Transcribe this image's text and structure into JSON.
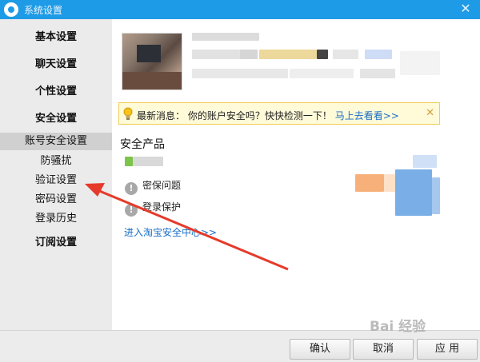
{
  "window": {
    "title": "系统设置",
    "close_icon": "close-icon"
  },
  "sidebar": {
    "items": [
      {
        "label": "基本设置"
      },
      {
        "label": "聊天设置"
      },
      {
        "label": "个性设置"
      },
      {
        "label": "安全设置"
      },
      {
        "label": "账号安全设置"
      },
      {
        "label": "防骚扰"
      },
      {
        "label": "验证设置"
      },
      {
        "label": "密码设置"
      },
      {
        "label": "登录历史"
      },
      {
        "label": "订阅设置"
      }
    ]
  },
  "notice": {
    "prefix": "最新消息：",
    "text": "你的账户安全吗？快快检测一下！",
    "link": "马上去看看>>",
    "icon": "lightbulb-icon"
  },
  "products": {
    "title": "安全产品",
    "items": [
      {
        "label": "密保问题"
      },
      {
        "label": "登录保护"
      }
    ],
    "link": "进入淘宝安全中心>>"
  },
  "footer": {
    "confirm": "确认",
    "cancel": "取消",
    "apply": "应 用"
  },
  "watermark": "Bai 经验",
  "colors": {
    "titlebar": "#1e9be6",
    "link": "#1a6ec6",
    "arrow": "#e63a2a",
    "notice_bg": "#fffbd9",
    "notice_border": "#f1cd58"
  }
}
